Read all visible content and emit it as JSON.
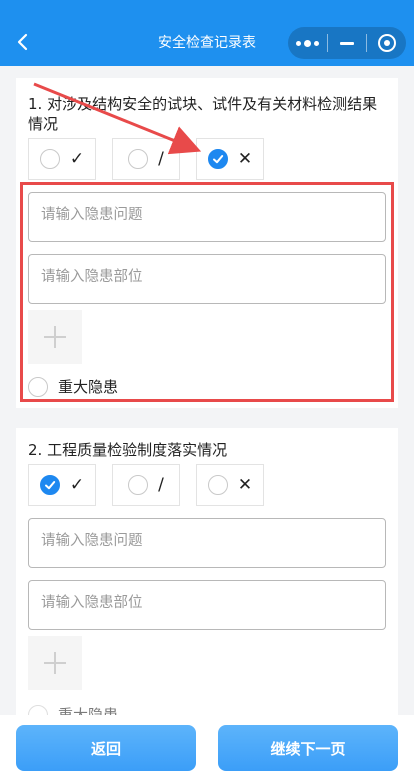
{
  "nav": {
    "title": "安全检查记录表",
    "back_icon": "chevron-left-icon",
    "capsule_icons": [
      "more-dots-icon",
      "minimize-icon",
      "close-target-icon"
    ]
  },
  "colors": {
    "nav_bg": "#1e90ef",
    "radio_checked": "#1e88f0",
    "highlight": "#e84a4a",
    "button": "#3b9ef8"
  },
  "questions": [
    {
      "title": "1. 对涉及结构安全的试块、试件及有关材料检测结果情况",
      "options": [
        {
          "mark": "✓",
          "checked": false
        },
        {
          "mark": "/",
          "checked": false
        },
        {
          "mark": "✕",
          "checked": true
        }
      ],
      "problem_placeholder": "请输入隐患问题",
      "location_placeholder": "请输入隐患部位",
      "major_label": "重大隐患",
      "major_checked": false
    },
    {
      "title": "2. 工程质量检验制度落实情况",
      "options": [
        {
          "mark": "✓",
          "checked": true
        },
        {
          "mark": "/",
          "checked": false
        },
        {
          "mark": "✕",
          "checked": false
        }
      ],
      "problem_placeholder": "请输入隐患问题",
      "location_placeholder": "请输入隐患部位",
      "major_label": "重大隐患",
      "major_checked": false
    }
  ],
  "footer": {
    "back_label": "返回",
    "next_label": "继续下一页"
  }
}
